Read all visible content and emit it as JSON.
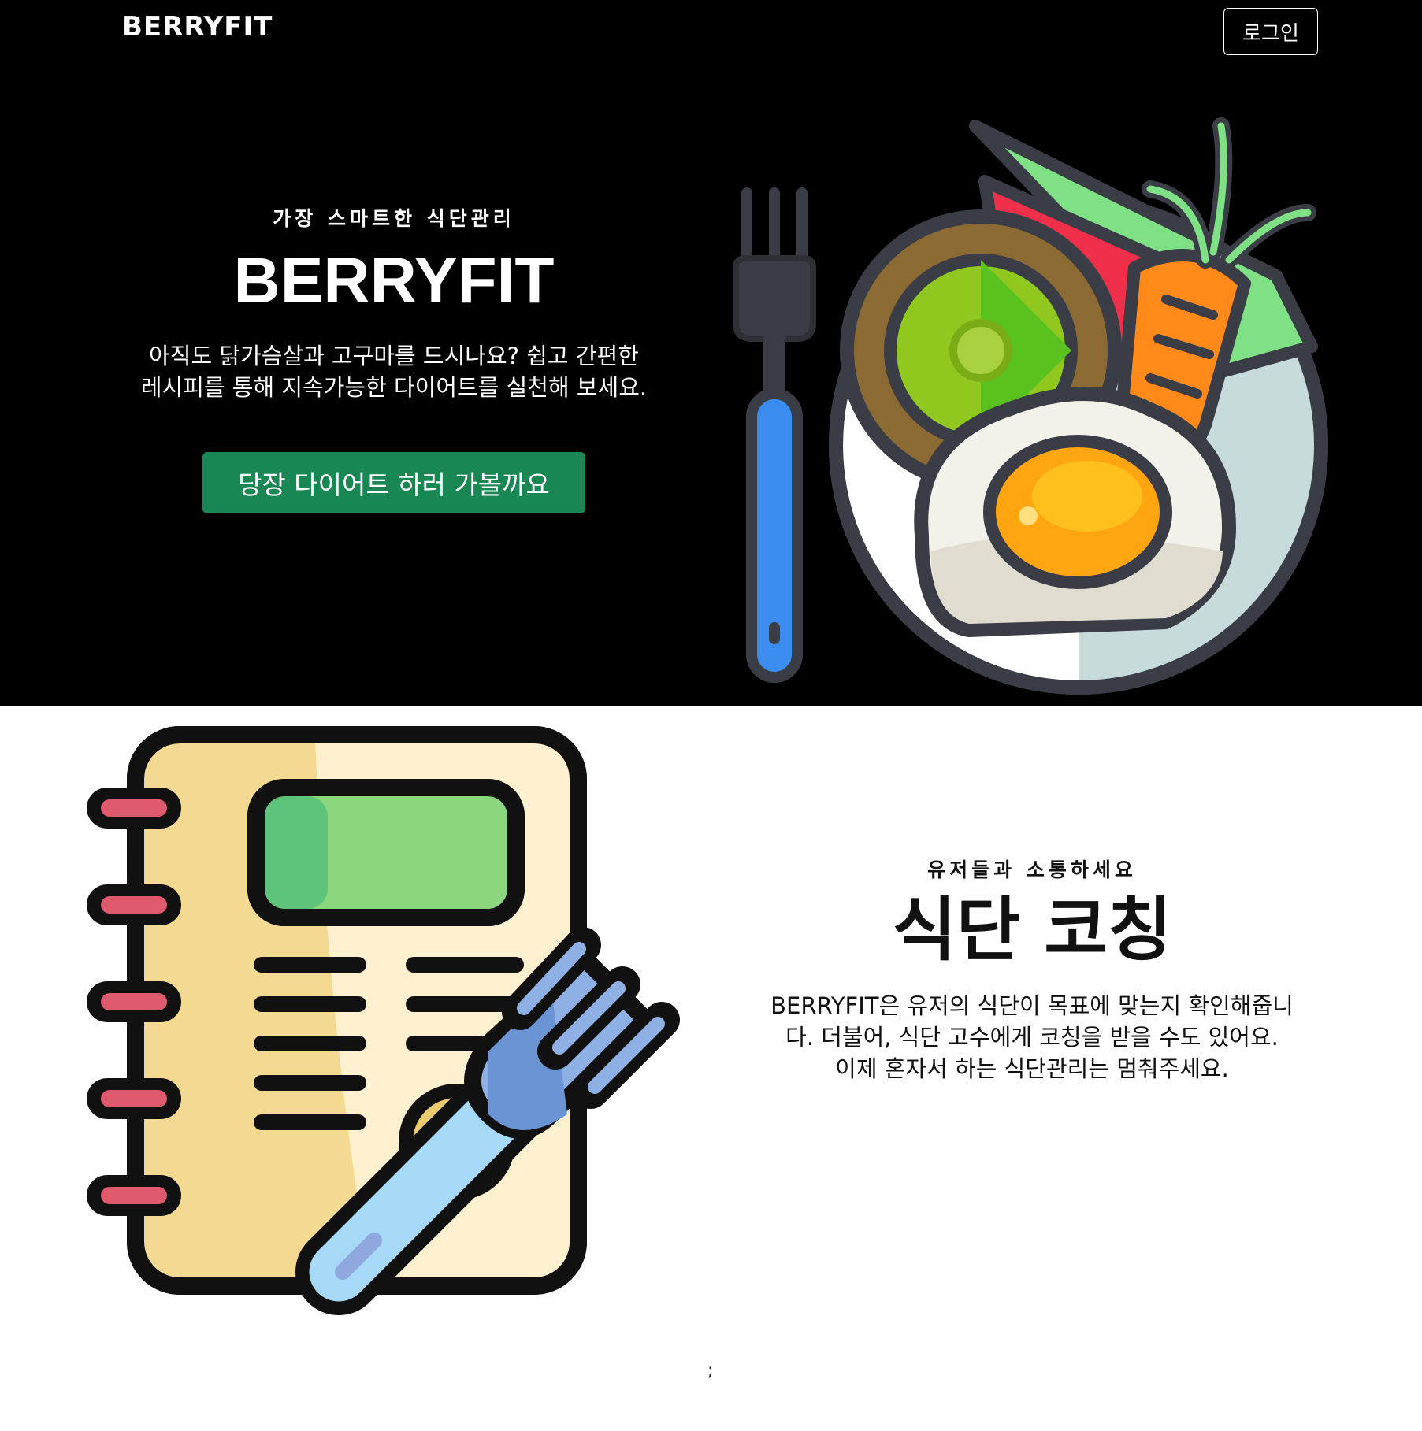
{
  "nav": {
    "logo": "BERRYFIT",
    "login_label": "로그인"
  },
  "hero": {
    "eyebrow": "가장 스마트한 식단관리",
    "title": "BERRYFIT",
    "description_line1": "아직도 닭가슴살과 고구마를 드시나요? 쉽고 간편한",
    "description_line2": "레시피를 통해 지속가능한 다이어트를 실천해 보세요.",
    "cta_label": "당장 다이어트 하러 가볼까요",
    "cta_color": "#198754",
    "illustration_icon": "plate-with-fork-icon"
  },
  "coaching": {
    "eyebrow": "유저들과 소통하세요",
    "title": "식단 코칭",
    "description_line1": "BERRYFIT은 유저의 식단이 목표에 맞는지 확인해줍니",
    "description_line2": "다. 더불어, 식단 고수에게 코칭을 받을 수도 있어요.",
    "description_line3": "이제 혼자서 하는 식단관리는 멈춰주세요.",
    "illustration_icon": "recipe-notebook-fork-icon"
  },
  "footer": {
    "stray_text": ";"
  }
}
